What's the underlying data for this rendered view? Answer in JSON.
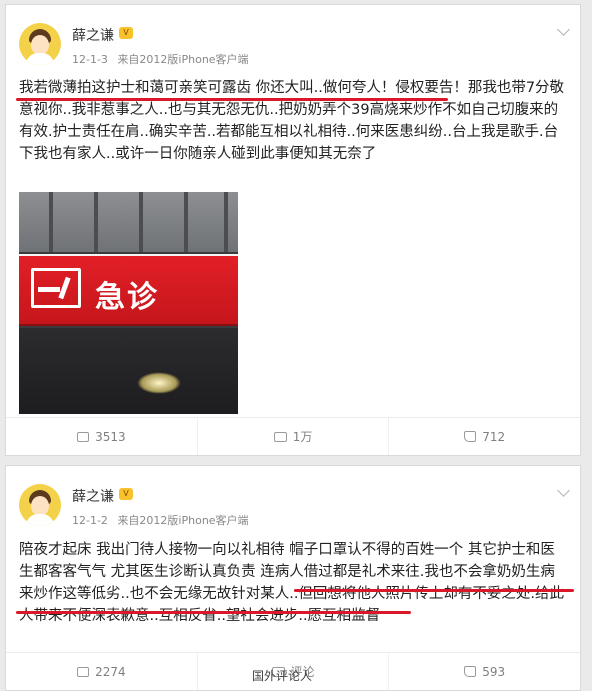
{
  "posts": [
    {
      "author": "薛之谦",
      "date": "12-1-3",
      "source": "来自2012版iPhone客户端",
      "text": "我若微薄拍这护士和蔼可亲笑可露齿 你还大叫..做何夸人！侵权要告！那我也带7分敬意视你..我非惹事之人..也与其无怨无仇..把奶奶弄个39高烧来炒作不如自己切腹来的有效.护士责任在肩..确实辛苦..若都能互相以礼相待..何来医患纠纷..台上我是歌手.台下我也有家人..或许一日你随亲人碰到此事便知其无奈了",
      "photo_sign": "急诊",
      "stats": {
        "repost": "3513",
        "comment": "1万",
        "like": "712"
      }
    },
    {
      "author": "薛之谦",
      "date": "12-1-2",
      "source": "来自2012版iPhone客户端",
      "text": "陪夜才起床 我出门待人接物一向以礼相待 帽子口罩认不得的百姓一个 其它护士和医生都客客气气 尤其医生诊断认真负责 连病人借过都是礼术来往.我也不会拿奶奶生病来炒作这等低劣..也不会无缘无故针对某人..但回想将他人照片传上却有不妥之处.给此人带来不便深表歉意..互相反省..望社会进步..愿互相监督",
      "stats": {
        "repost": "2274",
        "comment": "评论",
        "like": "593"
      }
    }
  ],
  "watermark": "国外评论人",
  "colors": {
    "underline": "#d9192a",
    "avatar_bg": "#f3d24a"
  }
}
